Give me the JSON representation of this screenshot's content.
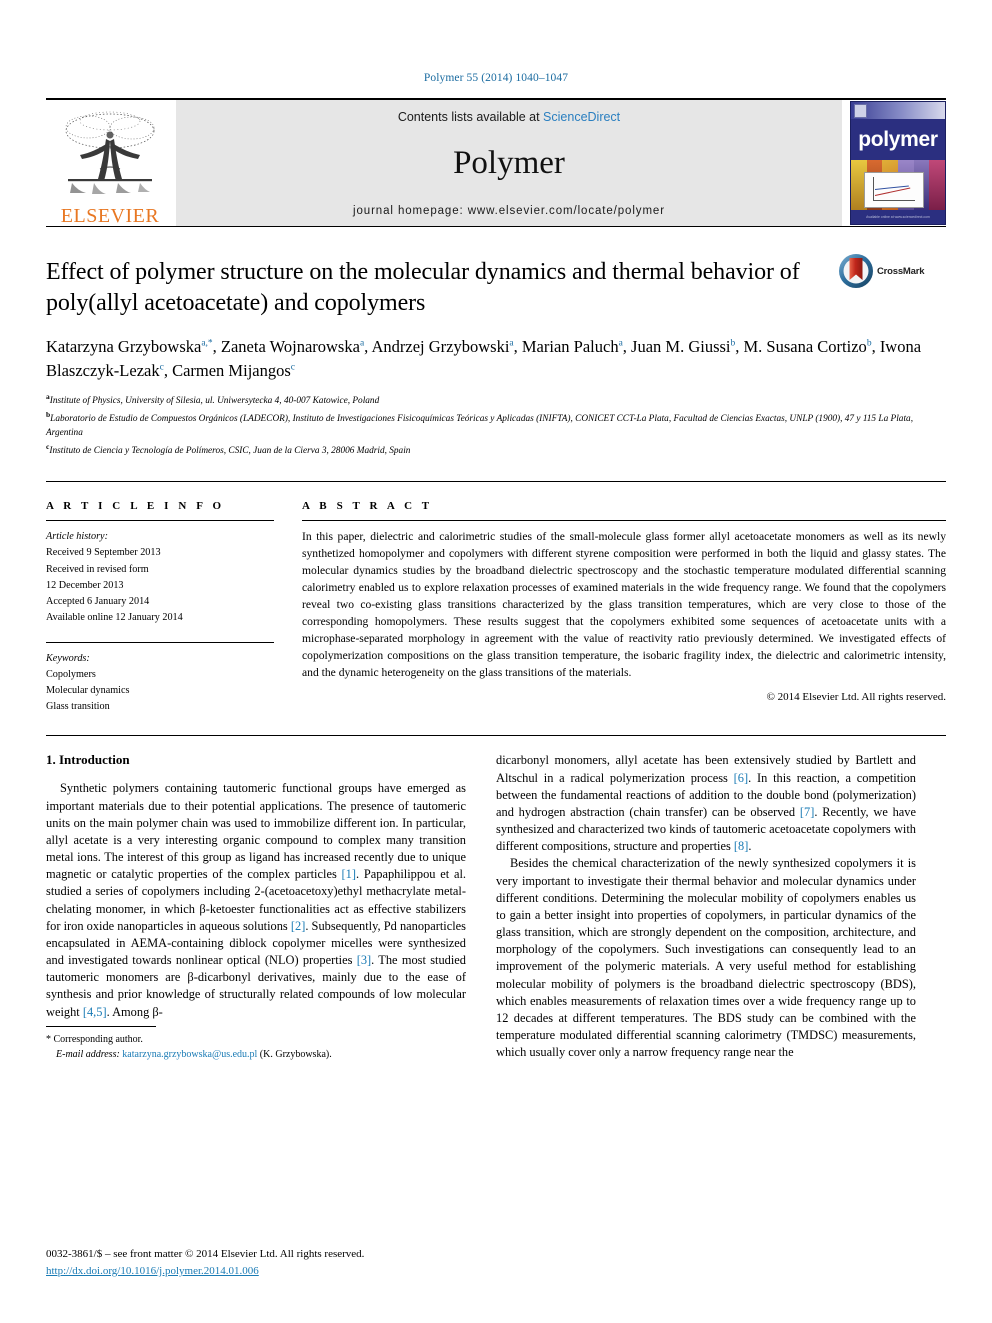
{
  "running_head": "Polymer 55 (2014) 1040–1047",
  "masthead": {
    "publisher_name": "ELSEVIER",
    "contents_prefix": "Contents lists available at ",
    "contents_link": "ScienceDirect",
    "journal_title": "Polymer",
    "homepage": "journal homepage: www.elsevier.com/locate/polymer",
    "cover_word": "polymer",
    "cover_footer": "Official Journal of the Polymer Division\nEditor-in-Chief: R. Stephen Williams"
  },
  "article": {
    "title": "Effect of polymer structure on the molecular dynamics and thermal behavior of poly(allyl acetoacetate) and copolymers",
    "crossmark_label": "CrossMark",
    "authors": [
      {
        "name": "Katarzyna Grzybowska",
        "marks": "a,*"
      },
      {
        "name": "Zaneta Wojnarowska",
        "marks": "a"
      },
      {
        "name": "Andrzej Grzybowski",
        "marks": "a"
      },
      {
        "name": "Marian Paluch",
        "marks": "a"
      },
      {
        "name": "Juan M. Giussi",
        "marks": "b"
      },
      {
        "name": "M. Susana Cortizo",
        "marks": "b"
      },
      {
        "name": "Iwona Blaszczyk-Lezak",
        "marks": "c"
      },
      {
        "name": "Carmen Mijangos",
        "marks": "c"
      }
    ],
    "affiliations": [
      {
        "mark": "a",
        "text": "Institute of Physics, University of Silesia, ul. Uniwersytecka 4, 40-007 Katowice, Poland"
      },
      {
        "mark": "b",
        "text": "Laboratorio de Estudio de Compuestos Orgánicos (LADECOR), Instituto de Investigaciones Fisicoquímicas Teóricas y Aplicadas (INIFTA), CONICET CCT-La Plata, Facultad de Ciencias Exactas, UNLP (1900), 47 y 115 La Plata, Argentina"
      },
      {
        "mark": "c",
        "text": "Instituto de Ciencia y Tecnología de Polímeros, CSIC, Juan de la Cierva 3, 28006 Madrid, Spain"
      }
    ]
  },
  "article_info": {
    "heading": "A R T I C L E   I N F O",
    "history_label": "Article history:",
    "history": [
      "Received 9 September 2013",
      "Received in revised form",
      "12 December 2013",
      "Accepted 6 January 2014",
      "Available online 12 January 2014"
    ],
    "keywords_label": "Keywords:",
    "keywords": [
      "Copolymers",
      "Molecular dynamics",
      "Glass transition"
    ]
  },
  "abstract": {
    "heading": "A B S T R A C T",
    "text": "In this paper, dielectric and calorimetric studies of the small-molecule glass former allyl acetoacetate monomers as well as its newly synthetized homopolymer and copolymers with different styrene composition were performed in both the liquid and glassy states. The molecular dynamics studies by the broadband dielectric spectroscopy and the stochastic temperature modulated differential scanning calorimetry enabled us to explore relaxation processes of examined materials in the wide frequency range. We found that the copolymers reveal two co-existing glass transitions characterized by the glass transition temperatures, which are very close to those of the corresponding homopolymers. These results suggest that the copolymers exhibited some sequences of acetoacetate units with a microphase-separated morphology in agreement with the value of reactivity ratio previously determined. We investigated effects of copolymerization compositions on the glass transition temperature, the isobaric fragility index, the dielectric and calorimetric intensity, and the dynamic heterogeneity on the glass transitions of the materials.",
    "copyright": "© 2014 Elsevier Ltd. All rights reserved."
  },
  "introduction": {
    "section_number": "1.",
    "section_title": "Introduction",
    "left_paragraph_1_a": "Synthetic polymers containing tautomeric functional groups have emerged as important materials due to their potential applications. The presence of tautomeric units on the main polymer chain was used to immobilize different ion. In particular, allyl acetate is a very interesting organic compound to complex many transition metal ions. The interest of this group as ligand has increased recently due to unique magnetic or catalytic properties of the complex particles ",
    "ref_1": "[1]",
    "left_paragraph_1_b": ". Papaphilippou et al. studied a series of copolymers including 2-(acetoacetoxy)ethyl methacrylate metal-chelating monomer, in which β-ketoester functionalities act as effective stabilizers for iron oxide nanoparticles in aqueous solutions ",
    "ref_2": "[2]",
    "left_paragraph_1_c": ". Subsequently, Pd nanoparticles encapsulated in AEMA-containing diblock copolymer micelles were synthesized and investigated towards nonlinear optical (NLO) properties ",
    "ref_3": "[3]",
    "left_paragraph_1_d": ". The most studied tautomeric monomers are β-dicarbonyl derivatives, mainly due to the ease of synthesis and prior knowledge of structurally related compounds of low molecular weight ",
    "ref_45": "[4,5]",
    "left_paragraph_1_e": ". Among β-",
    "right_paragraph_1_a": "dicarbonyl monomers, allyl acetate has been extensively studied by Bartlett and Altschul in a radical polymerization process ",
    "ref_6": "[6]",
    "right_paragraph_1_b": ". In this reaction, a competition between the fundamental reactions of addition to the double bond (polymerization) and hydrogen abstraction (chain transfer) can be observed ",
    "ref_7": "[7]",
    "right_paragraph_1_c": ". Recently, we have synthesized and characterized two kinds of tautomeric acetoacetate copolymers with different compositions, structure and properties ",
    "ref_8": "[8]",
    "right_paragraph_1_d": ".",
    "right_paragraph_2": "Besides the chemical characterization of the newly synthesized copolymers it is very important to investigate their thermal behavior and molecular dynamics under different conditions. Determining the molecular mobility of copolymers enables us to gain a better insight into properties of copolymers, in particular dynamics of the glass transition, which are strongly dependent on the composition, architecture, and morphology of the copolymers. Such investigations can consequently lead to an improvement of the polymeric materials. A very useful method for establishing molecular mobility of polymers is the broadband dielectric spectroscopy (BDS), which enables measurements of relaxation times over a wide frequency range up to 12 decades at different temperatures. The BDS study can be combined with the temperature modulated differential scanning calorimetry (TMDSC) measurements, which usually cover only a narrow frequency range near the"
  },
  "footnote": {
    "corresponding_marker": "*",
    "corresponding_label": "Corresponding author.",
    "email_label": "E-mail address:",
    "email": "katarzyna.grzybowska@us.edu.pl",
    "email_suffix": "(K. Grzybowska)."
  },
  "page_footer": {
    "issn_line": "0032-3861/$ – see front matter © 2014 Elsevier Ltd. All rights reserved.",
    "doi": "http://dx.doi.org/10.1016/j.polymer.2014.01.006"
  },
  "colors": {
    "link_blue": "#1a7bb5",
    "elsevier_orange": "#E87722",
    "cover_navy": "#2b2f80",
    "banner_gray": "#e6e6e6"
  }
}
